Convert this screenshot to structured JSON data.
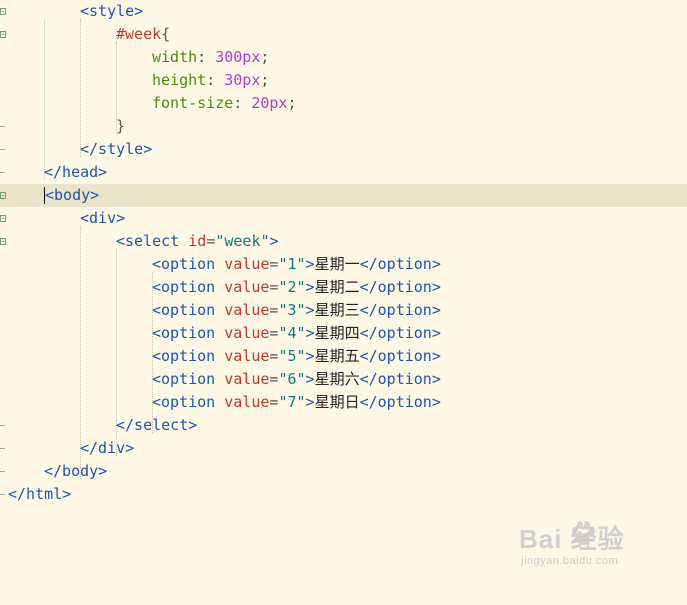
{
  "editor": {
    "lines": [
      {
        "tokens": [
          [
            "tag",
            "<style>"
          ]
        ]
      },
      {
        "tokens": [
          [
            "sel",
            "#week"
          ],
          [
            "punc",
            "{"
          ]
        ]
      },
      {
        "tokens": [
          [
            "prop",
            "width"
          ],
          [
            "punc",
            ": "
          ],
          [
            "num",
            "300px"
          ],
          [
            "punc",
            ";"
          ]
        ]
      },
      {
        "tokens": [
          [
            "prop",
            "height"
          ],
          [
            "punc",
            ": "
          ],
          [
            "num",
            "30px"
          ],
          [
            "punc",
            ";"
          ]
        ]
      },
      {
        "tokens": [
          [
            "prop",
            "font-size"
          ],
          [
            "punc",
            ": "
          ],
          [
            "num",
            "20px"
          ],
          [
            "punc",
            ";"
          ]
        ]
      },
      {
        "tokens": [
          [
            "punc",
            "}"
          ]
        ]
      },
      {
        "tokens": [
          [
            "tag",
            "</style>"
          ]
        ]
      },
      {
        "tokens": [
          [
            "tag",
            "</head>"
          ]
        ]
      },
      {
        "tokens": [
          [
            "tag",
            "<body>"
          ]
        ]
      },
      {
        "tokens": [
          [
            "tag",
            "<div>"
          ]
        ]
      },
      {
        "tokens": [
          [
            "tag",
            "<select "
          ],
          [
            "attr",
            "id"
          ],
          [
            "punc",
            "="
          ],
          [
            "val",
            "\"week\""
          ],
          [
            "tag",
            ">"
          ]
        ]
      },
      {
        "tokens": [
          [
            "tag",
            "<option "
          ],
          [
            "attr",
            "value"
          ],
          [
            "punc",
            "="
          ],
          [
            "val",
            "\"1\""
          ],
          [
            "tag",
            ">"
          ],
          [
            "txt",
            "星期一"
          ],
          [
            "tag",
            "</option>"
          ]
        ]
      },
      {
        "tokens": [
          [
            "tag",
            "<option "
          ],
          [
            "attr",
            "value"
          ],
          [
            "punc",
            "="
          ],
          [
            "val",
            "\"2\""
          ],
          [
            "tag",
            ">"
          ],
          [
            "txt",
            "星期二"
          ],
          [
            "tag",
            "</option>"
          ]
        ]
      },
      {
        "tokens": [
          [
            "tag",
            "<option "
          ],
          [
            "attr",
            "value"
          ],
          [
            "punc",
            "="
          ],
          [
            "val",
            "\"3\""
          ],
          [
            "tag",
            ">"
          ],
          [
            "txt",
            "星期三"
          ],
          [
            "tag",
            "</option>"
          ]
        ]
      },
      {
        "tokens": [
          [
            "tag",
            "<option "
          ],
          [
            "attr",
            "value"
          ],
          [
            "punc",
            "="
          ],
          [
            "val",
            "\"4\""
          ],
          [
            "tag",
            ">"
          ],
          [
            "txt",
            "星期四"
          ],
          [
            "tag",
            "</option>"
          ]
        ]
      },
      {
        "tokens": [
          [
            "tag",
            "<option "
          ],
          [
            "attr",
            "value"
          ],
          [
            "punc",
            "="
          ],
          [
            "val",
            "\"5\""
          ],
          [
            "tag",
            ">"
          ],
          [
            "txt",
            "星期五"
          ],
          [
            "tag",
            "</option>"
          ]
        ]
      },
      {
        "tokens": [
          [
            "tag",
            "<option "
          ],
          [
            "attr",
            "value"
          ],
          [
            "punc",
            "="
          ],
          [
            "val",
            "\"6\""
          ],
          [
            "tag",
            ">"
          ],
          [
            "txt",
            "星期六"
          ],
          [
            "tag",
            "</option>"
          ]
        ]
      },
      {
        "tokens": [
          [
            "tag",
            "<option "
          ],
          [
            "attr",
            "value"
          ],
          [
            "punc",
            "="
          ],
          [
            "val",
            "\"7\""
          ],
          [
            "tag",
            ">"
          ],
          [
            "txt",
            "星期日"
          ],
          [
            "tag",
            "</option>"
          ]
        ]
      },
      {
        "tokens": [
          [
            "tag",
            "</select>"
          ]
        ]
      },
      {
        "tokens": [
          [
            "tag",
            "</div>"
          ]
        ]
      },
      {
        "tokens": [
          [
            "tag",
            "</body>"
          ]
        ]
      },
      {
        "tokens": [
          [
            "tag",
            "</html>"
          ]
        ]
      }
    ]
  },
  "watermark": {
    "brand": "Bai  经验",
    "sub": "jingyan.baidu.com"
  },
  "colors": {
    "background": "#fdf8e6",
    "current_line": "#ece3cb",
    "tag": "#1f56a8",
    "attribute": "#c0392b",
    "value": "#0d7a7a",
    "selector": "#c0392b",
    "property": "#4f8a10",
    "number": "#b23dc6"
  }
}
